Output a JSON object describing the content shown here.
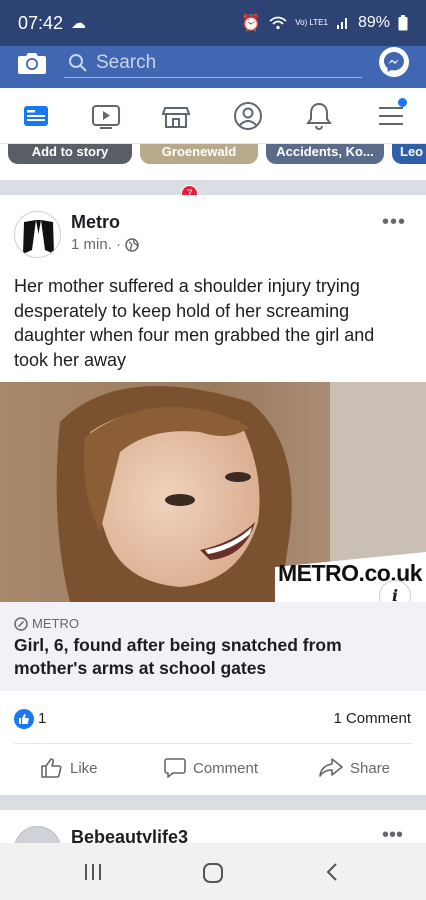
{
  "status_bar": {
    "time": "07:42",
    "signal_text": "Vo) LTE1",
    "battery": "89%"
  },
  "top_bar": {
    "search_placeholder": "Search"
  },
  "nav": {
    "marketplace_badge": "7"
  },
  "stories": [
    "Add to story",
    "Groenewald",
    "Accidents, Ko...",
    "Leo"
  ],
  "post": {
    "author": "Metro",
    "time": "1 min. ·",
    "text": "Her mother suffered a shoulder injury trying desperately to keep hold of her screaming daughter when four men grabbed the girl and took her away",
    "image_watermark": "METRO.co.uk",
    "link_source": "METRO",
    "link_headline": "Girl, 6, found after being snatched from mother's arms at school gates",
    "like_count": "1",
    "comment_count": "1 Comment",
    "actions": {
      "like": "Like",
      "comment": "Comment",
      "share": "Share"
    },
    "more": "•••"
  },
  "next_post": {
    "author": "Bebeautylife3",
    "more": "•••"
  },
  "colors": {
    "facebook_blue": "#4267b2",
    "status_bar": "#2d4373",
    "like_blue": "#1877f2",
    "badge_red": "#e41e3f"
  }
}
